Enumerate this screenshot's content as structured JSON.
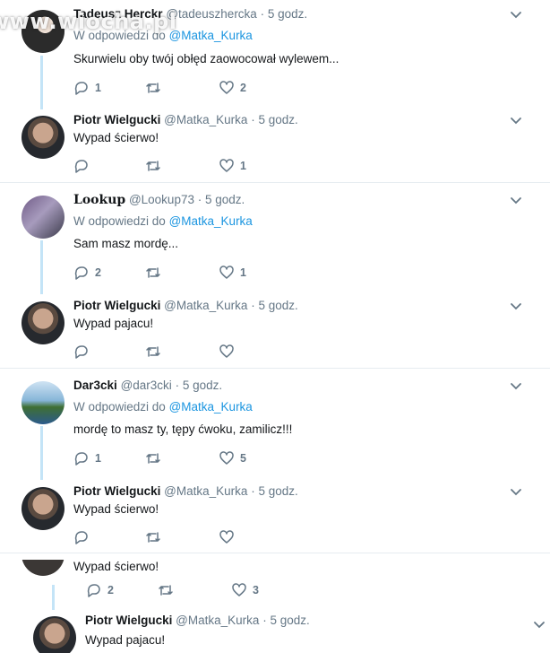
{
  "icons": {
    "reply": "reply-icon",
    "retweet": "retweet-icon",
    "like": "heart-icon",
    "menu": "chevron-down-icon"
  },
  "colors": {
    "link": "#1b95e0",
    "muted": "#657786",
    "thread": "#c4e4f7",
    "divider": "#e6ecf0"
  },
  "watermark": "www.wiocha.pl",
  "threads": [
    {
      "tweets": [
        {
          "name": "Tadeusz Herckr",
          "handle": "@tadeuszhercka",
          "dot": "·",
          "time": "5 godz.",
          "reply_prefix": "W odpowiedzi do",
          "reply_to": "@Matka_Kurka",
          "text": "Skurwielu oby twój obłęd zaowocował wylewem...",
          "replies": "1",
          "retweets": "",
          "likes": "2"
        },
        {
          "name": "Piotr Wielgucki",
          "handle": "@Matka_Kurka",
          "dot": "·",
          "time": "5 godz.",
          "text": "Wypad ścierwo!",
          "replies": "",
          "retweets": "",
          "likes": "1"
        }
      ]
    },
    {
      "tweets": [
        {
          "name": "Lookup",
          "handle": "@Lookup73",
          "dot": "·",
          "time": "5 godz.",
          "reply_prefix": "W odpowiedzi do",
          "reply_to": "@Matka_Kurka",
          "text": "Sam masz mordę...",
          "replies": "2",
          "retweets": "",
          "likes": "1"
        },
        {
          "name": "Piotr Wielgucki",
          "handle": "@Matka_Kurka",
          "dot": "·",
          "time": "5 godz.",
          "text": "Wypad pajacu!",
          "replies": "",
          "retweets": "",
          "likes": ""
        }
      ]
    },
    {
      "tweets": [
        {
          "name": "Dar3cki",
          "handle": "@dar3cki",
          "dot": "·",
          "time": "5 godz.",
          "reply_prefix": "W odpowiedzi do",
          "reply_to": "@Matka_Kurka",
          "text": "mordę to masz ty, tępy ćwoku, zamilicz!!!",
          "replies": "1",
          "retweets": "",
          "likes": "5"
        },
        {
          "name": "Piotr Wielgucki",
          "handle": "@Matka_Kurka",
          "dot": "·",
          "time": "5 godz.",
          "text": "Wypad ścierwo!",
          "replies": "",
          "retweets": "",
          "likes": ""
        }
      ]
    },
    {
      "stub": {
        "text": "Wypad ścierwo!",
        "replies": "2",
        "retweets": "",
        "likes": "3"
      },
      "tweets": [
        {
          "name": "Piotr Wielgucki",
          "handle": "@Matka_Kurka",
          "dot": "·",
          "time": "5 godz.",
          "text": "Wypad pajacu!"
        }
      ]
    }
  ]
}
